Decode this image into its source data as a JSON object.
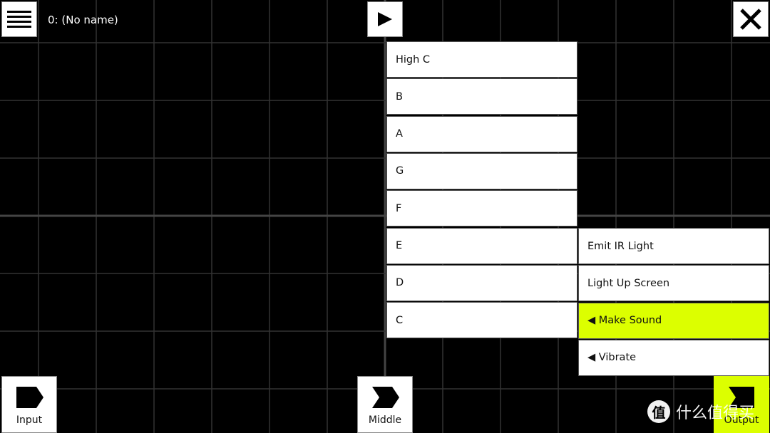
{
  "header": {
    "title": "0: (No name)",
    "menu_icon": "hamburger-icon",
    "play_icon": "play-icon",
    "close_icon": "close-icon"
  },
  "notes_menu": {
    "items": [
      "High C",
      "B",
      "A",
      "G",
      "F",
      "E",
      "D",
      "C"
    ]
  },
  "output_menu": {
    "items": [
      {
        "label": "Emit IR Light",
        "selected": false
      },
      {
        "label": "Light Up Screen",
        "selected": false
      },
      {
        "label": "◀ Make Sound",
        "selected": true
      },
      {
        "label": "◀ Vibrate",
        "selected": false
      }
    ]
  },
  "nodes": {
    "input": "Input",
    "middle": "Middle",
    "output": "Output"
  },
  "colors": {
    "accent": "#dcff00",
    "background": "#000000",
    "grid": "#333333"
  },
  "watermark": {
    "badge": "值",
    "text": "什么值得买"
  }
}
